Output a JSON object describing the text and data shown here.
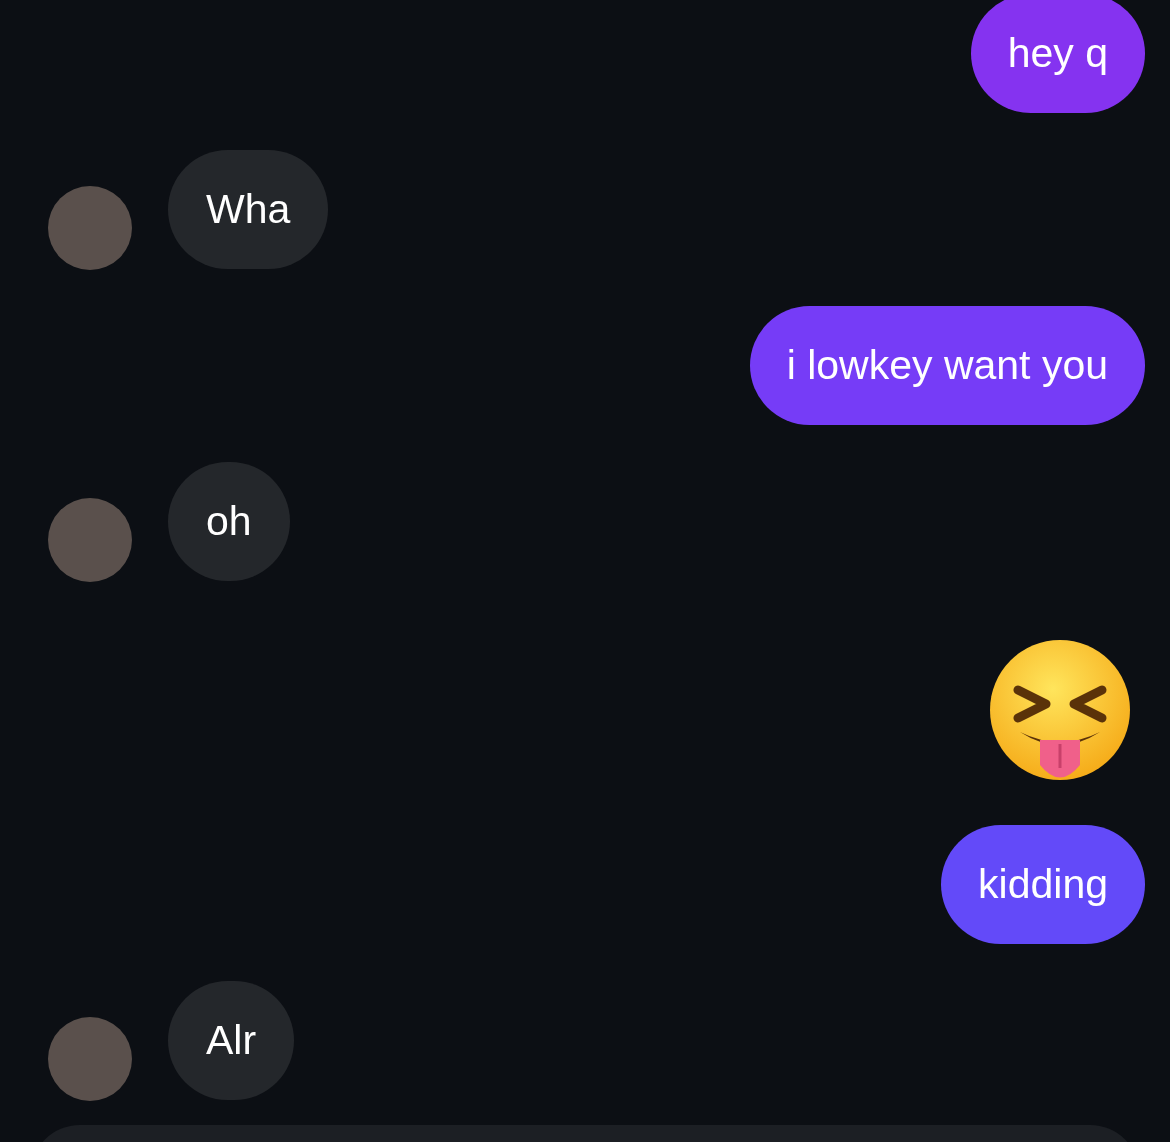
{
  "messages": [
    {
      "kind": "sent",
      "text": "hey q",
      "color": "#8533f0"
    },
    {
      "kind": "received",
      "text": "Wha"
    },
    {
      "kind": "sent",
      "text": "i lowkey want you",
      "color": "#763cf7"
    },
    {
      "kind": "received",
      "text": "oh"
    },
    {
      "kind": "emoji"
    },
    {
      "kind": "sent",
      "text": "kidding",
      "color": "#634af9"
    },
    {
      "kind": "received",
      "text": "Alr"
    }
  ],
  "composer": {
    "visible": true
  }
}
